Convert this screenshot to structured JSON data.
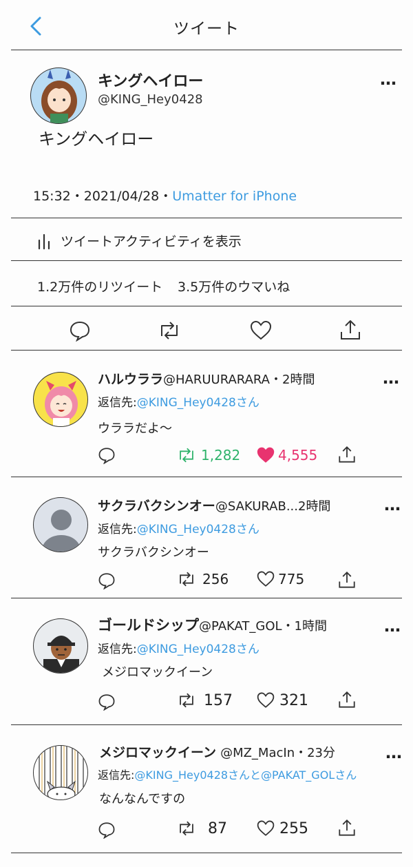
{
  "header": {
    "title": "ツイート"
  },
  "main_tweet": {
    "author_name": "キングヘイロー",
    "author_handle": "@KING_Hey0428",
    "more": "…",
    "text": "キングヘイロー",
    "time": "15:32・2021/04/28・",
    "client": "Umatter for iPhone",
    "activity_label": "ツイートアクティビティを表示",
    "retweet_stat": "1.2万件のリツイート",
    "like_stat": "3.5万件のウマいね"
  },
  "replies": [
    {
      "name": "ハルウララ",
      "handle": "@HARUURARARA・2時間",
      "reply_prefix": "返信先:",
      "reply_to": "@KING_Hey0428さん",
      "text": "ウララだよ〜",
      "retweets": "1,282",
      "likes": "4,555",
      "liked": true,
      "retweeted": true
    },
    {
      "name": "サクラバクシンオー",
      "handle": "@SAKURAB...2時間",
      "reply_prefix": "返信先:",
      "reply_to": "@KING_Hey0428さん",
      "text": "サクラバクシンオー",
      "retweets": "256",
      "likes": "775",
      "liked": false,
      "retweeted": false
    },
    {
      "name": "ゴールドシップ",
      "handle": "@PAKAT_GOL・1時間",
      "reply_prefix": "返信先:",
      "reply_to": "@KING_Hey0428さん",
      "text": "メジロマックイーン",
      "retweets": "157",
      "likes": "321",
      "liked": false,
      "retweeted": false
    },
    {
      "name": "メジロマックイーン",
      "handle": "@MZ_MacIn・23分",
      "reply_prefix": "返信先:",
      "reply_to": "@KING_Hey0428さんと@PAKAT_GOLさん",
      "text": "なんなんですの",
      "retweets": "87",
      "likes": "255",
      "liked": false,
      "retweeted": false
    }
  ],
  "icons": {
    "back": "chevron-left-icon",
    "reply": "speech-bubble-icon",
    "retweet": "retweet-arrows-icon",
    "like": "heart-icon",
    "share": "share-upload-icon",
    "activity": "bar-chart-icon"
  },
  "colors": {
    "accent": "#3d9be0",
    "retweet_active": "#2fb36b",
    "like_active": "#e8336f",
    "line": "#333333"
  }
}
